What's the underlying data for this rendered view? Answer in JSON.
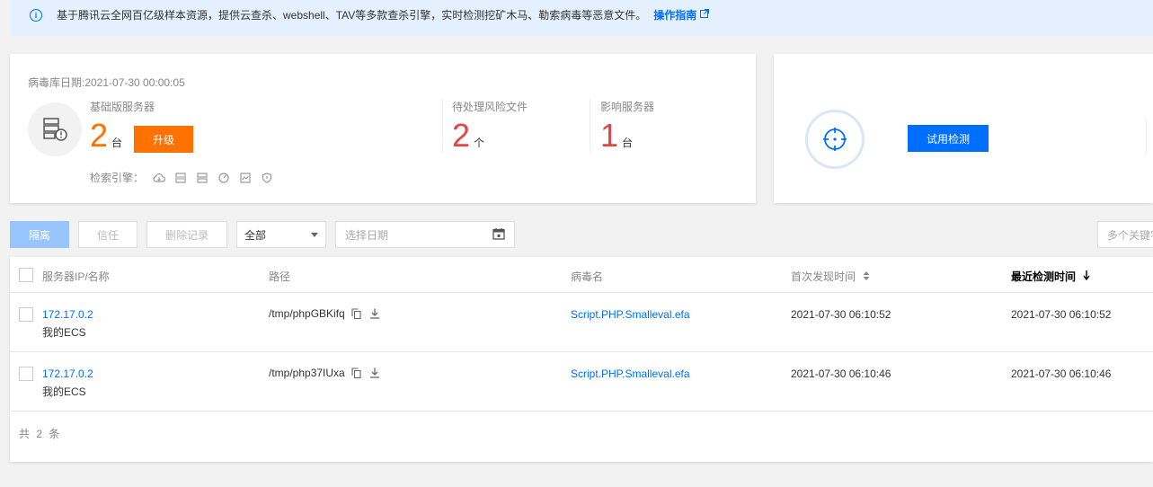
{
  "notice": {
    "text": "基于腾讯云全网百亿级样本资源，提供云查杀、webshell、TAV等多款查杀引擎，实时检测挖矿木马、勒索病毒等恶意文件。",
    "link": "操作指南"
  },
  "summary": {
    "db_date": "病毒库日期:2021-07-30 00:00:05",
    "basic_servers_label": "基础版服务器",
    "basic_servers_count": "2",
    "basic_servers_unit": "台",
    "upgrade_label": "升级",
    "pending_files_label": "待处理风险文件",
    "pending_files_count": "2",
    "pending_files_unit": "个",
    "affected_servers_label": "影响服务器",
    "affected_servers_count": "1",
    "affected_servers_unit": "台",
    "engines_label": "检索引擎："
  },
  "scan": {
    "trial_label": "试用检测"
  },
  "toolbar": {
    "isolate": "隔离",
    "trust": "信任",
    "delete": "删除记录",
    "filter_value": "全部",
    "date_placeholder": "选择日期",
    "search_placeholder": "多个关键字"
  },
  "table": {
    "columns": [
      "服务器IP/名称",
      "路径",
      "病毒名",
      "首次发现时间",
      "最近检测时间"
    ],
    "rows": [
      {
        "ip": "172.17.0.2",
        "name": "我的ECS",
        "path": "/tmp/phpGBKifq",
        "virus": "Script.PHP.Smalleval.efa",
        "first_seen": "2021-07-30 06:10:52",
        "last_seen": "2021-07-30 06:10:52"
      },
      {
        "ip": "172.17.0.2",
        "name": "我的ECS",
        "path": "/tmp/php37IUxa",
        "virus": "Script.PHP.Smalleval.efa",
        "first_seen": "2021-07-30 06:10:46",
        "last_seen": "2021-07-30 06:10:46"
      }
    ],
    "total": "共 2 条"
  },
  "colors": {
    "accent": "#006eff",
    "orange": "#ff7200",
    "red": "#e54545"
  }
}
